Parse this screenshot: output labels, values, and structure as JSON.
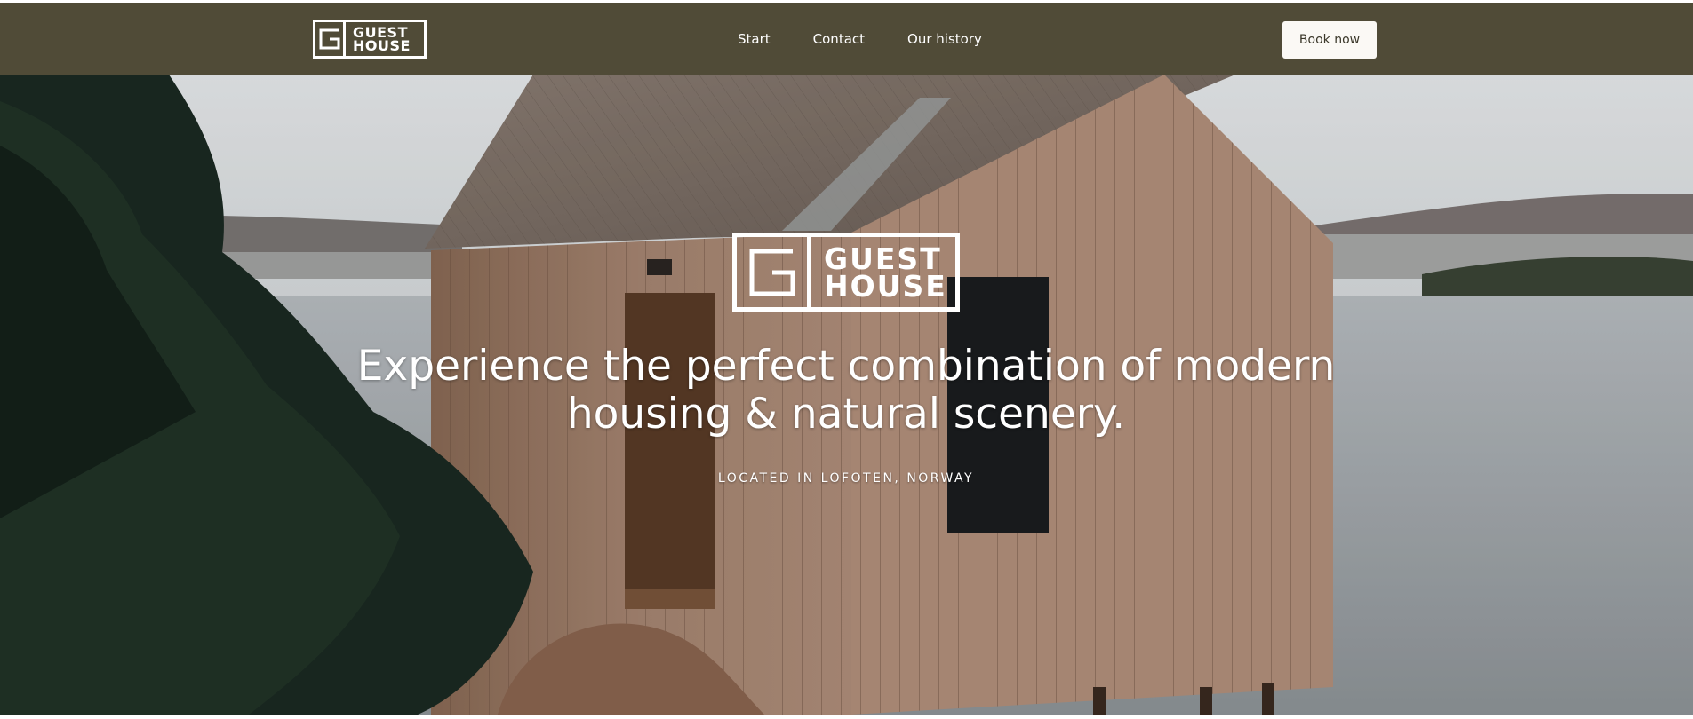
{
  "header": {
    "logo": {
      "line1": "GUEST",
      "line2": "HOUSE"
    },
    "nav": [
      {
        "label": "Start"
      },
      {
        "label": "Contact"
      },
      {
        "label": "Our history"
      }
    ],
    "book_button": "Book now",
    "background_color": "#504b37"
  },
  "hero": {
    "logo": {
      "line1": "GUEST",
      "line2": "HOUSE"
    },
    "headline_line1": "Experience the perfect combination of modern",
    "headline_line2": "housing & natural scenery.",
    "location": "LOCATED IN LOFOTEN, NORWAY"
  }
}
